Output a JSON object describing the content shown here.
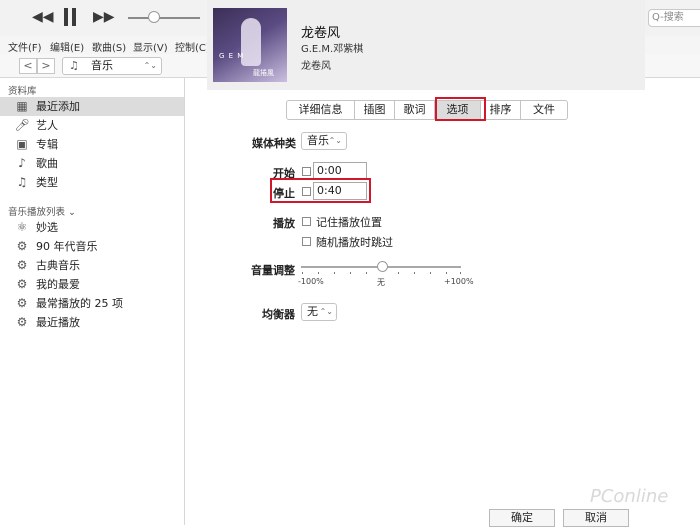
{
  "toolbar": {
    "prev_icon": "rewind-icon",
    "play_icon": "pause-icon",
    "next_icon": "fast-forward-icon",
    "search_placeholder": "Q-搜索"
  },
  "menu": [
    "文件(F)",
    "编辑(E)",
    "歌曲(S)",
    "显示(V)",
    "控制(C)"
  ],
  "nav": {
    "back": "<",
    "forward": ">",
    "library": "音乐"
  },
  "sidebar": {
    "library_header": "资料库",
    "library_items": [
      {
        "label": "最近添加",
        "icon": "grid-icon"
      },
      {
        "label": "艺人",
        "icon": "microphone-icon"
      },
      {
        "label": "专辑",
        "icon": "album-icon"
      },
      {
        "label": "歌曲",
        "icon": "music-note-icon"
      },
      {
        "label": "类型",
        "icon": "genre-icon"
      }
    ],
    "playlist_header": "音乐播放列表 ⌄",
    "playlist_items": [
      {
        "label": "妙选",
        "icon": "genius-icon"
      },
      {
        "label": "90 年代音乐",
        "icon": "gear-icon"
      },
      {
        "label": "古典音乐",
        "icon": "gear-icon"
      },
      {
        "label": "我的最爱",
        "icon": "gear-icon"
      },
      {
        "label": "最常播放的 25 项",
        "icon": "gear-icon"
      },
      {
        "label": "最近播放",
        "icon": "gear-icon"
      }
    ]
  },
  "now_playing": {
    "title": "龙卷风",
    "artist": "G.E.M.邓紫棋",
    "album": "龙卷风",
    "art_text": "G E M",
    "art_sub": "龍捲風"
  },
  "tabs": [
    "详细信息",
    "插图",
    "歌词",
    "选项",
    "排序",
    "文件"
  ],
  "options": {
    "media_kind_label": "媒体种类",
    "media_kind_value": "音乐",
    "start_label": "开始",
    "start_value": "0:00",
    "stop_label": "停止",
    "stop_value": "0:40",
    "playback_label": "播放",
    "remember_label": "记住播放位置",
    "shuffle_label": "随机播放时跳过",
    "volume_label": "音量调整",
    "volume_min": "-100%",
    "volume_mid": "无",
    "volume_max": "+100%",
    "eq_label": "均衡器",
    "eq_value": "无"
  },
  "buttons": {
    "ok": "确定",
    "cancel": "取消"
  },
  "watermark": "PConline",
  "colors": {
    "highlight": "#d0182a",
    "selected_row": "#dcdcdc"
  }
}
